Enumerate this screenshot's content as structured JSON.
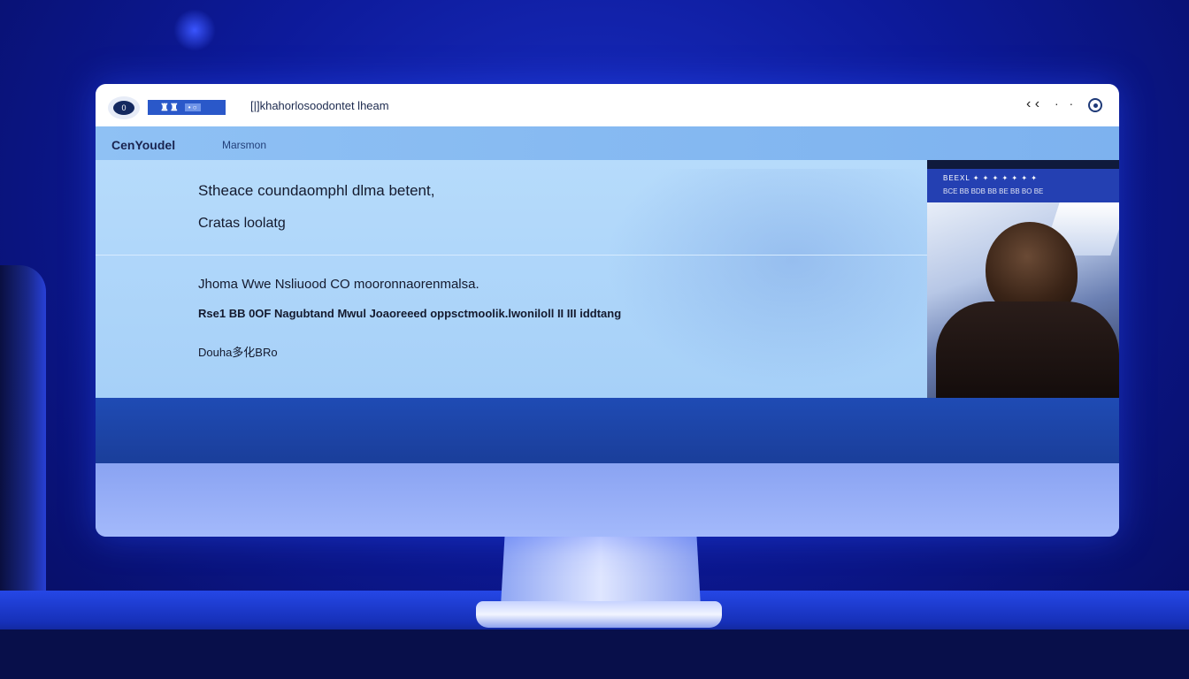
{
  "titlebar": {
    "logo_text": "0",
    "chip_glyphs": "♜♜",
    "chip_dots": "• ○",
    "title": "[|]khahorlosoodontet lheam",
    "back_glyph": "‹ ‹",
    "dots_glyph": "· ·"
  },
  "navbar": {
    "brand": "CenYoudel",
    "item": "Marsmon"
  },
  "content": {
    "line1": "Stheace coundaomphl dlma betent,",
    "line2": "Cratas loolatg",
    "line3": "Jhoma Wwe Nsliuood CO mooronnaorenmalsa.",
    "line4": "Rse1 BB 0OF Nagubtand Mwul Joaoreeed oppsctmoolik.lwoniloll II III iddtang",
    "line5": "Douha多化BRo"
  },
  "side_panel": {
    "header_top": "BEEXL ✦ ✦ ✦ ✦ ✦ ✦ ✦",
    "header_sub": "BCE  BB  BDB  BB  BE  BB  BO  BE"
  },
  "colors": {
    "background": "#0d1a9a",
    "titlebar": "#ffffff",
    "navbar": "#8fc1f4",
    "content": "#b6dbfb",
    "band": "#1f4bb4",
    "footer": "#a3b9fb",
    "accent": "#2a58c9"
  },
  "icons": [
    "eye-logo-icon",
    "back-icon",
    "more-icon",
    "circle-menu-icon"
  ]
}
